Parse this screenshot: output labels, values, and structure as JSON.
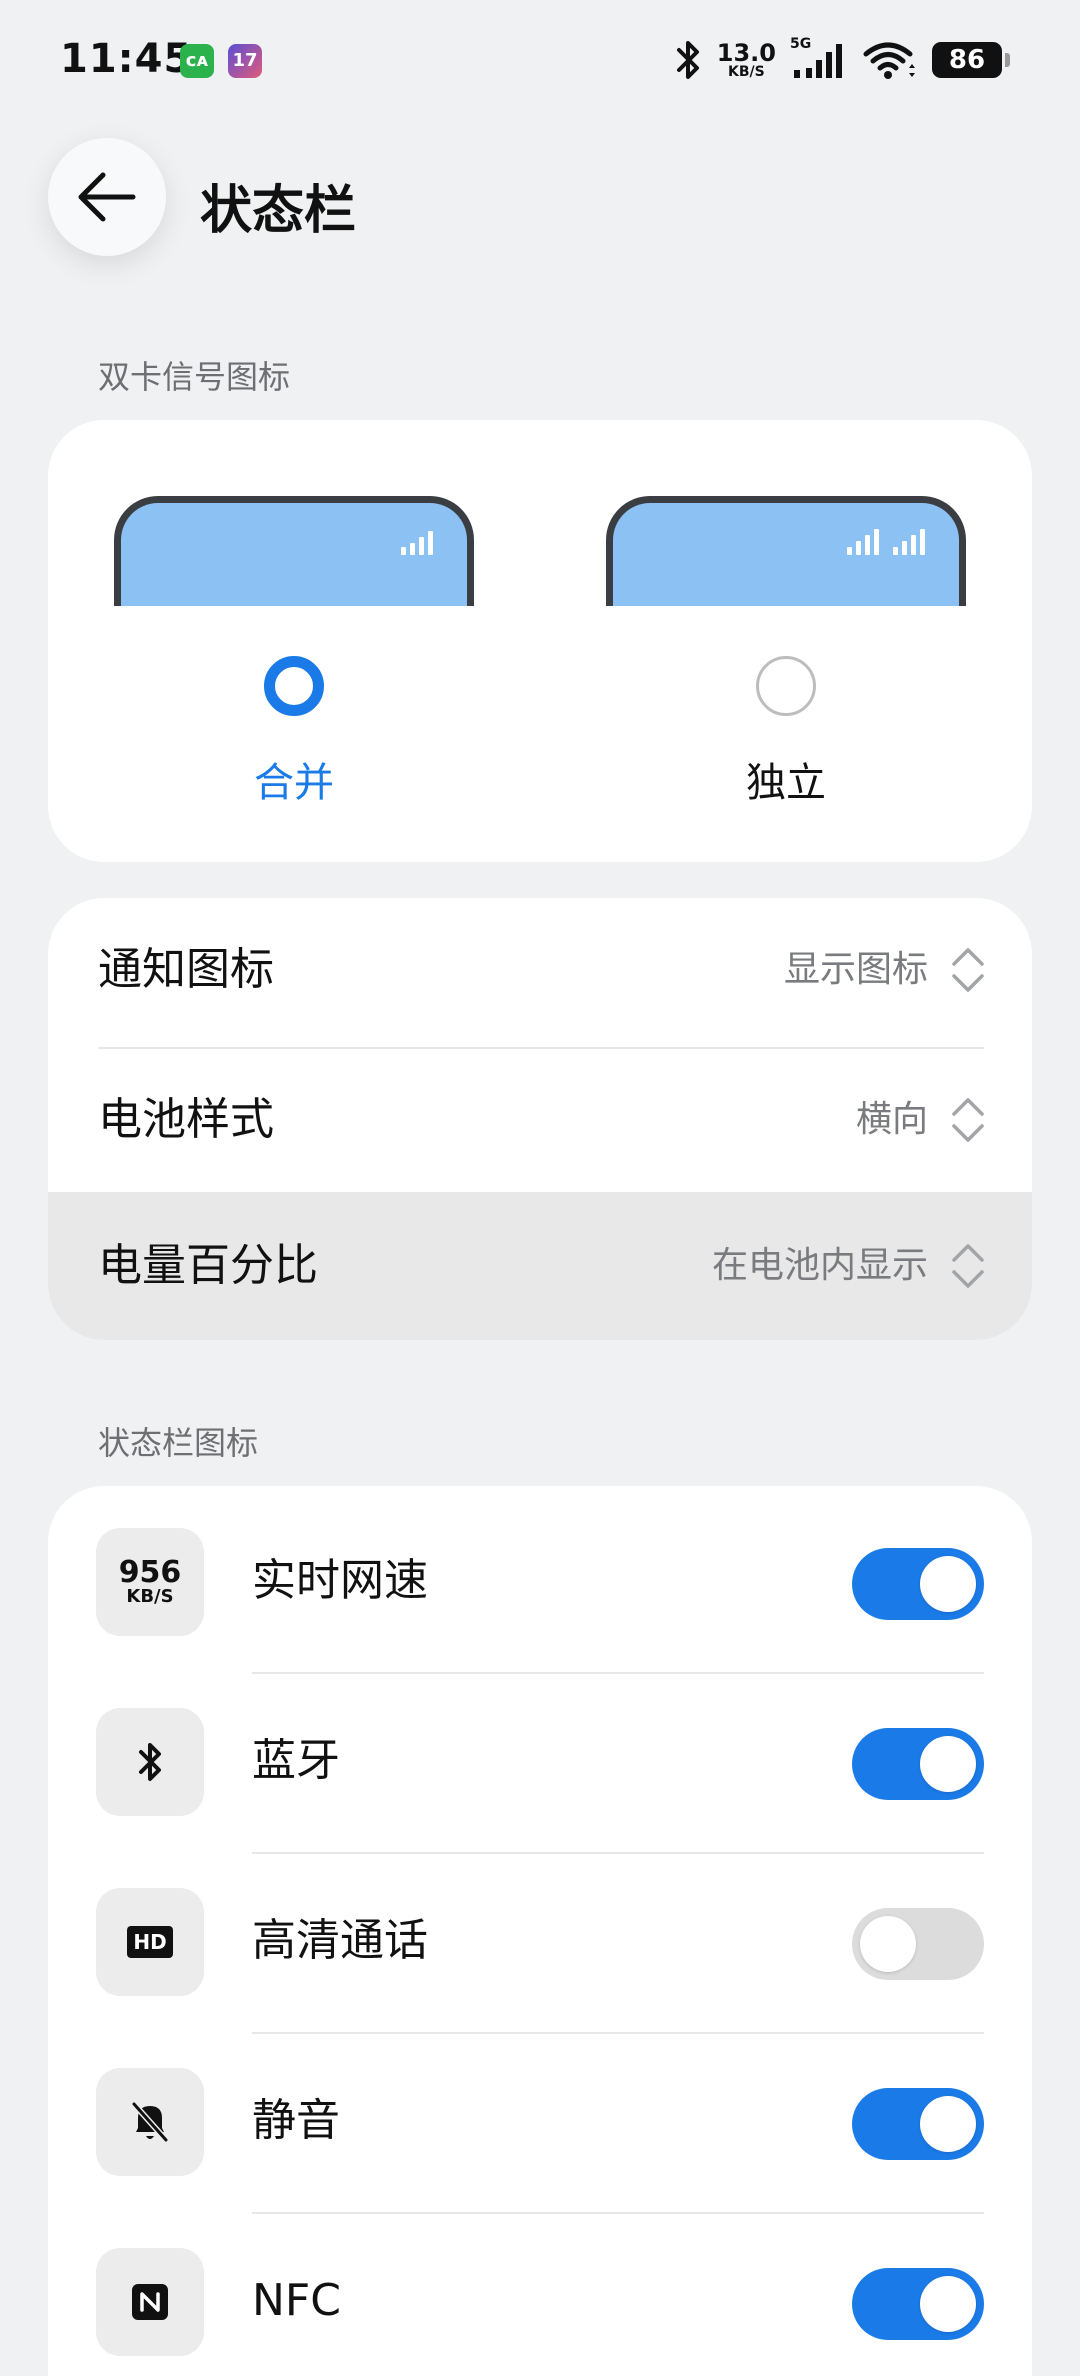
{
  "status_bar": {
    "time": "11:45",
    "net_speed_value": "13.0",
    "net_speed_unit": "KB/S",
    "network_type": "5G",
    "battery": "86"
  },
  "header": {
    "back_icon": "arrow-left-icon",
    "title": "状态栏"
  },
  "dual_sim": {
    "section_label": "双卡信号图标",
    "options": [
      {
        "label": "合并",
        "selected": true
      },
      {
        "label": "独立",
        "selected": false
      }
    ]
  },
  "display_settings": [
    {
      "label": "通知图标",
      "value": "显示图标"
    },
    {
      "label": "电池样式",
      "value": "横向"
    },
    {
      "label": "电量百分比",
      "value": "在电池内显示"
    }
  ],
  "status_icons": {
    "section_label": "状态栏图标",
    "items": [
      {
        "label": "实时网速",
        "icon": "net-speed-icon",
        "icon_value": "956",
        "icon_unit": "KB/S",
        "enabled": true
      },
      {
        "label": "蓝牙",
        "icon": "bluetooth-icon",
        "enabled": true
      },
      {
        "label": "高清通话",
        "icon": "hd-call-icon",
        "icon_text": "HD",
        "enabled": false
      },
      {
        "label": "静音",
        "icon": "mute-bell-icon",
        "enabled": true
      },
      {
        "label": "NFC",
        "icon": "nfc-icon",
        "enabled": true
      }
    ]
  },
  "colors": {
    "accent": "#1a7be8",
    "background": "#eff1f3",
    "card": "#ffffff",
    "secondary_text": "#7a7b7e"
  }
}
